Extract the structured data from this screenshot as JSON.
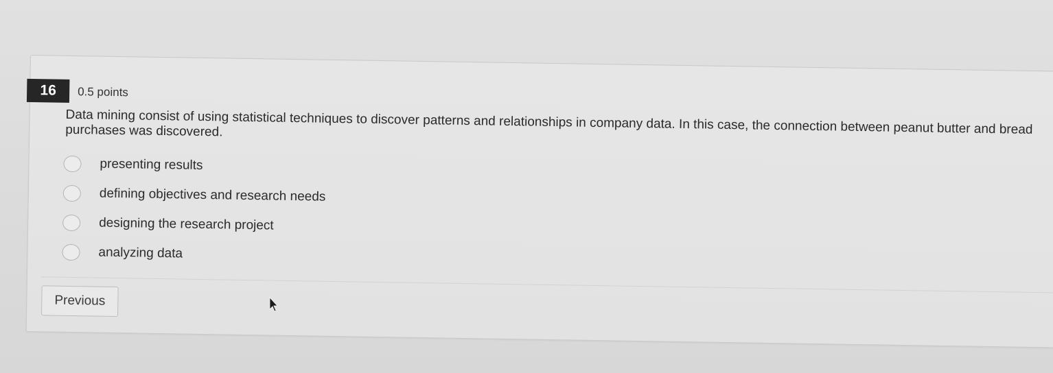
{
  "question": {
    "number": "16",
    "points": "0.5 points",
    "text": "Data mining consist of using statistical techniques to discover patterns and relationships in company data. In this case, the connection between peanut butter and bread purchases was discovered.",
    "options": [
      {
        "label": "presenting results",
        "selected": false
      },
      {
        "label": "defining objectives and research needs",
        "selected": false
      },
      {
        "label": "designing the research project",
        "selected": false
      },
      {
        "label": "analyzing data",
        "selected": false
      }
    ]
  },
  "navigation": {
    "previous_label": "Previous"
  },
  "icons": {
    "cursor": "mouse-pointer-icon"
  },
  "colors": {
    "number_badge_bg": "#262626",
    "number_badge_text": "#ffffff",
    "background": "#dedede"
  }
}
